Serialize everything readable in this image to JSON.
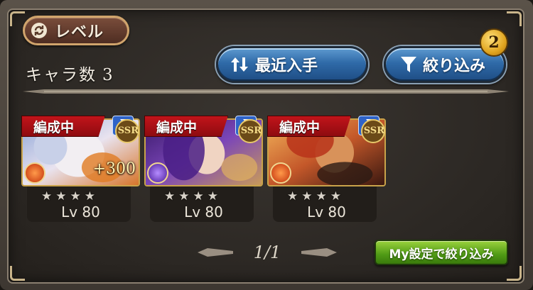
{
  "sort_button": {
    "label": "レベル",
    "icon": "refresh-icon"
  },
  "character_count": {
    "label": "キャラ数",
    "value": "3"
  },
  "buttons": {
    "recent": {
      "label": "最近入手",
      "icon": "sort-updown-icon"
    },
    "filter": {
      "label": "絞り込み",
      "icon": "funnel-icon",
      "badge": "2"
    }
  },
  "cards": [
    {
      "tag": "編成中",
      "rarity": "SSR",
      "element": "fire",
      "element_color": "#d8401a",
      "bonus": "+300",
      "stars": 4,
      "level": "Lv 80"
    },
    {
      "tag": "編成中",
      "rarity": "SSR",
      "element": "dark",
      "element_color": "#6a2fb0",
      "bonus": "",
      "stars": 4,
      "level": "Lv 80"
    },
    {
      "tag": "編成中",
      "rarity": "SSR",
      "element": "fire",
      "element_color": "#d8401a",
      "bonus": "",
      "stars": 4,
      "level": "Lv 80"
    }
  ],
  "pagination": {
    "text": "1/1"
  },
  "my_filter_button": {
    "label": "My設定で絞り込み"
  },
  "colors": {
    "accent_blue": "#2f6aa8",
    "accent_green": "#4f9a15",
    "tag_red": "#c2141a"
  }
}
